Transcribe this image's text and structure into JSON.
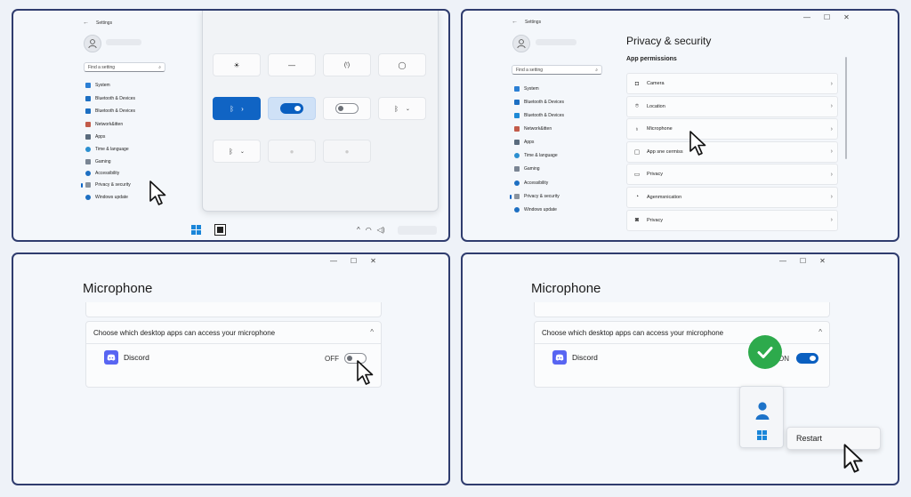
{
  "settings_nav": {
    "app_title": "Settings",
    "search_placeholder": "Find a setting",
    "panel1_items": [
      "System",
      "Bluetooth & Devices",
      "Bluetooth & Devices",
      "Network&itten",
      "Apps",
      "Time & language",
      "Gaming",
      "Accessibility",
      "Privacy & security",
      "Windows update"
    ],
    "panel2_items": [
      "System",
      "Bluetooth & Devices",
      "Bluetooth & Devices",
      "Network&itten",
      "Apps",
      "Time & language",
      "Gaming",
      "Accessibility",
      "Privacy & security",
      "Windows update"
    ],
    "selected": "Privacy & security"
  },
  "privacy": {
    "title": "Privacy & security",
    "section": "App permissions",
    "rows": [
      "Camera",
      "Location",
      "Microphone",
      "App sne cermiss",
      "Privacy",
      "Agenmsnication",
      "Privacy"
    ]
  },
  "mic_off": {
    "title": "Microphone",
    "prompt": "Choose which desktop apps can access your microphone",
    "app": "Discord",
    "state_label": "OFF"
  },
  "mic_on": {
    "title": "Microphone",
    "prompt": "Choose which desktop apps can access your microphone",
    "app": "Discord",
    "state_label": "ON",
    "restart_label": "Restart"
  },
  "colors": {
    "accent": "#0a5fc0",
    "panel_border": "#2f3c6e",
    "success": "#2daa4c",
    "discord": "#5865f2"
  }
}
